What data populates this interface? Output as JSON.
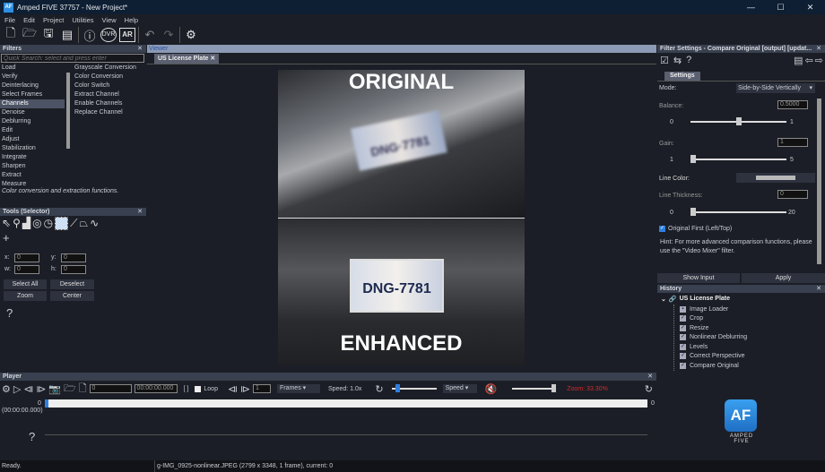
{
  "window": {
    "title": "Amped FIVE 37757 - New Project*",
    "logo": "AF",
    "controls": [
      "—",
      "☐",
      "✕"
    ]
  },
  "menu": [
    "File",
    "Edit",
    "Project",
    "Utilities",
    "View",
    "Help"
  ],
  "toolbar": [
    "new-project-icon",
    "open-icon",
    "save-icon",
    "film-icon",
    "info-icon",
    "dvr-icon",
    "ar-icon",
    "undo-icon",
    "redo-icon",
    "gear-icon"
  ],
  "filters": {
    "title": "Filters",
    "search_placeholder": "Quick Search: select and press enter",
    "categories": [
      "Load",
      "Verify",
      "Deinterlacing",
      "Select Frames",
      "Channels",
      "Denoise",
      "Deblurring",
      "Edit",
      "Adjust",
      "Stabilization",
      "Integrate",
      "Sharpen",
      "Extract",
      "Measure"
    ],
    "selected": "Channels",
    "items": [
      "Grayscale Conversion",
      "Color Conversion",
      "Color Switch",
      "Extract Channel",
      "Enable Channels",
      "Replace Channel"
    ],
    "description": "Color conversion and extraction functions."
  },
  "tools": {
    "title": "Tools (Selector)",
    "x_label": "x:",
    "y_label": "y:",
    "w_label": "w:",
    "h_label": "h:",
    "x": "0",
    "y": "0",
    "w": "0",
    "h": "0",
    "select_all": "Select All",
    "deselect": "Deselect",
    "zoom": "Zoom",
    "center": "Center",
    "help": "?"
  },
  "viewer": {
    "title": "Viewer",
    "tab": "US License Plate",
    "label_top": "ORIGINAL",
    "label_bottom": "ENHANCED",
    "plate_top": "DNG·7781",
    "plate_bottom": "DNG-7781"
  },
  "filter_settings": {
    "title": "Filter Settings - Compare Original [output] [updat...",
    "tab": "Settings",
    "mode_label": "Mode:",
    "mode_value": "Side-by-Side Vertically",
    "balance_label": "Balance:",
    "balance_value": "0.5000",
    "balance_min": "0",
    "balance_max": "1",
    "balance_fraction": 0.5,
    "gain_label": "Gain:",
    "gain_value": "1",
    "gain_min": "1",
    "gain_max": "5",
    "gain_fraction": 0,
    "line_color_label": "Line Color:",
    "line_color": "#b8b8b8",
    "thickness_label": "Line Thickness:",
    "thickness_value": "0",
    "thickness_min": "0",
    "thickness_max": "20",
    "thickness_fraction": 0,
    "original_first_label": "Original First (Left/Top)",
    "original_first": true,
    "hint": "Hint: For more advanced comparison functions, please use the \"Video Mixer\" filter.",
    "show_input": "Show Input",
    "apply": "Apply"
  },
  "history": {
    "title": "History",
    "root": "US License Plate",
    "items": [
      "Image Loader",
      "Crop",
      "Resize",
      "Nonlinear Deblurring",
      "Levels",
      "Correct Perspective",
      "Compare Original"
    ]
  },
  "brand": {
    "logo": "AF",
    "name": "AMPED FIVE"
  },
  "player": {
    "title": "Player",
    "frame": "0",
    "time": "00:00:00.000",
    "brackets": "[ ]",
    "loop": "Loop",
    "step": "1",
    "unit": "Frames",
    "speed": "Speed: 1.0x",
    "speed_mode": "Speed",
    "zoom": "Zoom: 33.30%",
    "zoom_color": "#d22b2b",
    "start": "0",
    "end": "0",
    "start_time": "(00:00:00.000)",
    "help": "?",
    "progress": 0
  },
  "status": {
    "left": "Ready.",
    "right": "g-IMG_0925-nonlinear.JPEG (2799 x 3348, 1 frame), current: 0"
  }
}
